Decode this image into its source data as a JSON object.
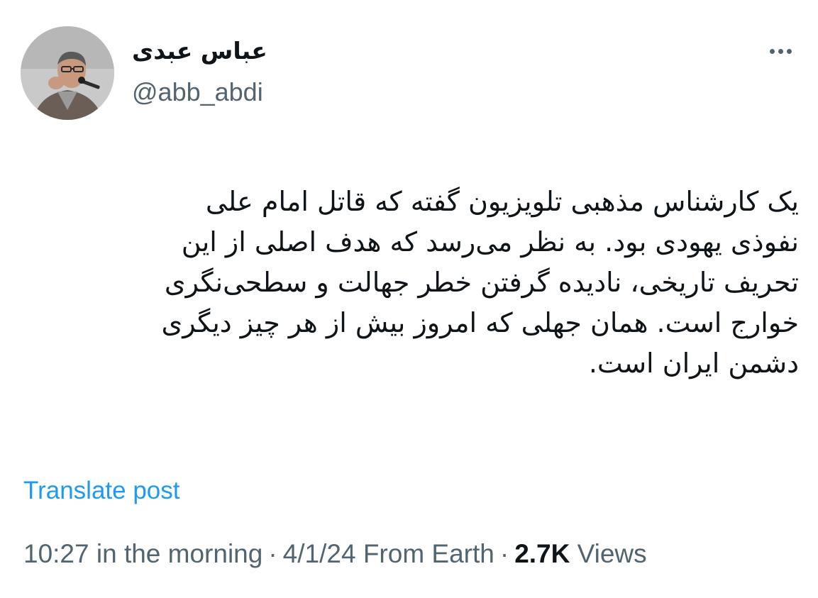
{
  "author": {
    "display_name": "عباس عبدی",
    "handle": "@abb_abdi"
  },
  "icons": {
    "more": "more-horizontal-icon"
  },
  "tweet": {
    "lines": [
      "یک کارشناس مذهبی تلویزیون گفته که قاتل امام علی",
      "نفوذی یهودی بود. به نظر می‌رسد که هدف اصلی از این",
      "تحریف تاریخی، نادیده گرفتن خطر جهالت و سطحی‌نگری",
      "خوارج است. همان جهلی که امروز بیش از هر چیز دیگری",
      "دشمن ایران است."
    ]
  },
  "translate_label": "Translate post",
  "meta": {
    "time": "10:27 in the morning",
    "separator": "·",
    "date_source": "4/1/24 From Earth",
    "views_count": "2.7K",
    "views_label": "Views"
  },
  "colors": {
    "text_primary": "#0f1419",
    "text_secondary": "#536471",
    "link": "#1d9bf0"
  }
}
